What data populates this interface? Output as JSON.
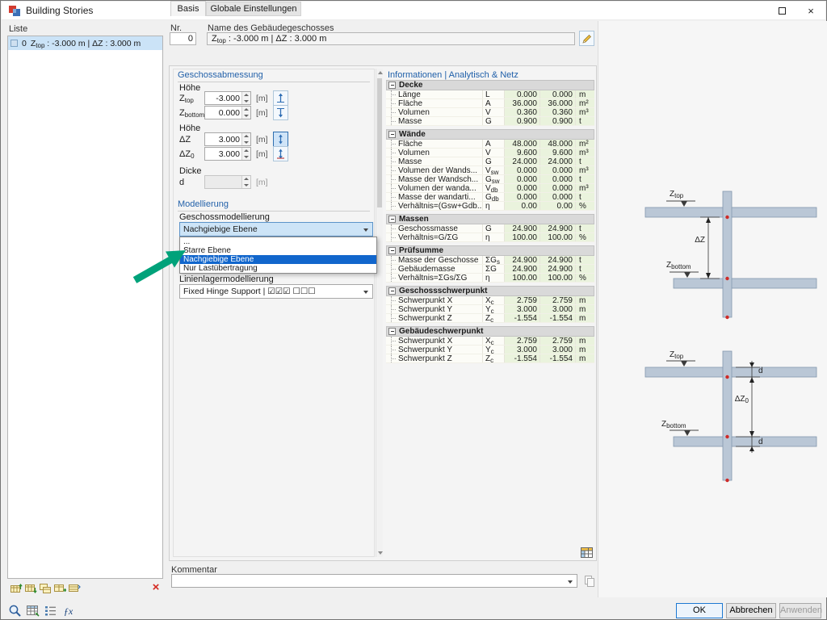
{
  "window": {
    "title": "Building Stories"
  },
  "icons": {
    "close": "×",
    "delete": "×",
    "fx": "ƒx"
  },
  "list_panel": {
    "header": "Liste",
    "items": [
      {
        "no": "0",
        "parts": [
          {
            "t": "Z"
          },
          {
            "t": "top",
            "sub": true
          },
          {
            "t": " : -3.000 m | ΔZ : 3.000 m"
          }
        ]
      }
    ]
  },
  "header": {
    "nr_label": "Nr.",
    "nr_value": "0",
    "name_label": "Name des Gebäudegeschosses",
    "name_parts": [
      {
        "t": "Z"
      },
      {
        "t": "top",
        "sub": true
      },
      {
        "t": " : -3.000 m | ΔZ : 3.000 m"
      }
    ]
  },
  "tabs": [
    {
      "label": "Basis"
    },
    {
      "label": "Globale Einstellungen"
    }
  ],
  "abmessung": {
    "title": "Geschossabmessung",
    "hoehe1": "Höhe",
    "hoehe2": "Höhe",
    "dicke": "Dicke",
    "rows1": [
      {
        "label": [
          {
            "t": "Z"
          },
          {
            "t": "top",
            "sub": true
          }
        ],
        "value": "-3.000",
        "unit": "[m]"
      },
      {
        "label": [
          {
            "t": "Z"
          },
          {
            "t": "bottom",
            "sub": true
          }
        ],
        "value": "0.000",
        "unit": "[m]"
      }
    ],
    "rows2": [
      {
        "label": [
          {
            "t": "ΔZ"
          }
        ],
        "value": "3.000",
        "unit": "[m]"
      },
      {
        "label": [
          {
            "t": "ΔZ"
          },
          {
            "t": "0",
            "sub": true
          }
        ],
        "value": "3.000",
        "unit": "[m]"
      }
    ],
    "dicke_row": {
      "label": [
        {
          "t": "d"
        }
      ],
      "value": "",
      "unit": "[m]"
    }
  },
  "modellierung": {
    "title": "Modellierung",
    "geschoss_label": "Geschossmodellierung",
    "geschoss_value": "Nachgiebige Ebene",
    "options": [
      "...",
      "Starre Ebene",
      "Nachgiebige Ebene",
      "Nur Lastübertragung"
    ],
    "selected_option_index": 2,
    "linienlager_label": "Linienlagermodellierung",
    "linienlager_value": "Fixed Hinge Support | ☑☑☑ ☐☐☐"
  },
  "info": {
    "header": "Informationen | Analytisch & Netz",
    "groups": [
      {
        "name": "Decke",
        "rows": [
          {
            "label": "Länge",
            "sym": [
              {
                "t": "L"
              }
            ],
            "v1": "0.000",
            "v2": "0.000",
            "unit": "m"
          },
          {
            "label": "Fläche",
            "sym": [
              {
                "t": "A"
              }
            ],
            "v1": "36.000",
            "v2": "36.000",
            "unit": "m²"
          },
          {
            "label": "Volumen",
            "sym": [
              {
                "t": "V"
              }
            ],
            "v1": "0.360",
            "v2": "0.360",
            "unit": "m³"
          },
          {
            "label": "Masse",
            "sym": [
              {
                "t": "G"
              }
            ],
            "v1": "0.900",
            "v2": "0.900",
            "unit": "t"
          }
        ]
      },
      {
        "name": "Wände",
        "rows": [
          {
            "label": "Fläche",
            "sym": [
              {
                "t": "A"
              }
            ],
            "v1": "48.000",
            "v2": "48.000",
            "unit": "m²"
          },
          {
            "label": "Volumen",
            "sym": [
              {
                "t": "V"
              }
            ],
            "v1": "9.600",
            "v2": "9.600",
            "unit": "m³"
          },
          {
            "label": "Masse",
            "sym": [
              {
                "t": "G"
              }
            ],
            "v1": "24.000",
            "v2": "24.000",
            "unit": "t"
          },
          {
            "label": "Volumen der Wands...",
            "sym": [
              {
                "t": "V"
              },
              {
                "t": "sw",
                "sub": true
              }
            ],
            "v1": "0.000",
            "v2": "0.000",
            "unit": "m³"
          },
          {
            "label": "Masse der Wandsch...",
            "sym": [
              {
                "t": "G"
              },
              {
                "t": "sw",
                "sub": true
              }
            ],
            "v1": "0.000",
            "v2": "0.000",
            "unit": "t"
          },
          {
            "label": "Volumen der wanda...",
            "sym": [
              {
                "t": "V"
              },
              {
                "t": "db",
                "sub": true
              }
            ],
            "v1": "0.000",
            "v2": "0.000",
            "unit": "m³"
          },
          {
            "label": "Masse der wandarti...",
            "sym": [
              {
                "t": "G"
              },
              {
                "t": "db",
                "sub": true
              }
            ],
            "v1": "0.000",
            "v2": "0.000",
            "unit": "t"
          },
          {
            "label": "Verhältnis=(Gsw+Gdb...",
            "sym": [
              {
                "t": "η"
              }
            ],
            "v1": "0.00",
            "v2": "0.00",
            "unit": "%"
          }
        ]
      },
      {
        "name": "Massen",
        "rows": [
          {
            "label": "Geschossmasse",
            "sym": [
              {
                "t": "G"
              }
            ],
            "v1": "24.900",
            "v2": "24.900",
            "unit": "t"
          },
          {
            "label": "Verhältnis=G/ΣG",
            "sym": [
              {
                "t": "η"
              }
            ],
            "v1": "100.00",
            "v2": "100.00",
            "unit": "%"
          }
        ]
      },
      {
        "name": "Prüfsumme",
        "rows": [
          {
            "label": "Masse der Geschosse",
            "sym": [
              {
                "t": "ΣG"
              },
              {
                "t": "s",
                "sub": true
              }
            ],
            "v1": "24.900",
            "v2": "24.900",
            "unit": "t"
          },
          {
            "label": "Gebäudemasse",
            "sym": [
              {
                "t": "ΣG"
              }
            ],
            "v1": "24.900",
            "v2": "24.900",
            "unit": "t"
          },
          {
            "label": "Verhältnis=ΣGs/ΣG",
            "sym": [
              {
                "t": "η"
              }
            ],
            "v1": "100.00",
            "v2": "100.00",
            "unit": "%"
          }
        ]
      },
      {
        "name": "Geschossschwerpunkt",
        "rows": [
          {
            "label": "Schwerpunkt X",
            "sym": [
              {
                "t": "X"
              },
              {
                "t": "c",
                "sub": true
              }
            ],
            "v1": "2.759",
            "v2": "2.759",
            "unit": "m"
          },
          {
            "label": "Schwerpunkt Y",
            "sym": [
              {
                "t": "Y"
              },
              {
                "t": "c",
                "sub": true
              }
            ],
            "v1": "3.000",
            "v2": "3.000",
            "unit": "m"
          },
          {
            "label": "Schwerpunkt Z",
            "sym": [
              {
                "t": "Z"
              },
              {
                "t": "c",
                "sub": true
              }
            ],
            "v1": "-1.554",
            "v2": "-1.554",
            "unit": "m"
          }
        ]
      },
      {
        "name": "Gebäudeschwerpunkt",
        "rows": [
          {
            "label": "Schwerpunkt X",
            "sym": [
              {
                "t": "X"
              },
              {
                "t": "c",
                "sub": true
              }
            ],
            "v1": "2.759",
            "v2": "2.759",
            "unit": "m"
          },
          {
            "label": "Schwerpunkt Y",
            "sym": [
              {
                "t": "Y"
              },
              {
                "t": "c",
                "sub": true
              }
            ],
            "v1": "3.000",
            "v2": "3.000",
            "unit": "m"
          },
          {
            "label": "Schwerpunkt Z",
            "sym": [
              {
                "t": "Z"
              },
              {
                "t": "c",
                "sub": true
              }
            ],
            "v1": "-1.554",
            "v2": "-1.554",
            "unit": "m"
          }
        ]
      }
    ]
  },
  "kommentar": {
    "label": "Kommentar"
  },
  "diagram": {
    "top": {
      "ztop": [
        {
          "t": "Z"
        },
        {
          "t": "top",
          "sub": true
        }
      ],
      "dz": [
        {
          "t": "ΔZ"
        }
      ],
      "zbottom": [
        {
          "t": "Z"
        },
        {
          "t": "bottom",
          "sub": true
        }
      ]
    },
    "bottom": {
      "ztop": [
        {
          "t": "Z"
        },
        {
          "t": "top",
          "sub": true
        }
      ],
      "d_top": "d",
      "dz0": [
        {
          "t": "ΔZ"
        },
        {
          "t": "0",
          "sub": true
        }
      ],
      "zbottom": [
        {
          "t": "Z"
        },
        {
          "t": "bottom",
          "sub": true
        }
      ],
      "d_bottom": "d"
    }
  },
  "footer": {
    "ok": "OK",
    "cancel": "Abbrechen",
    "apply": "Anwenden"
  }
}
